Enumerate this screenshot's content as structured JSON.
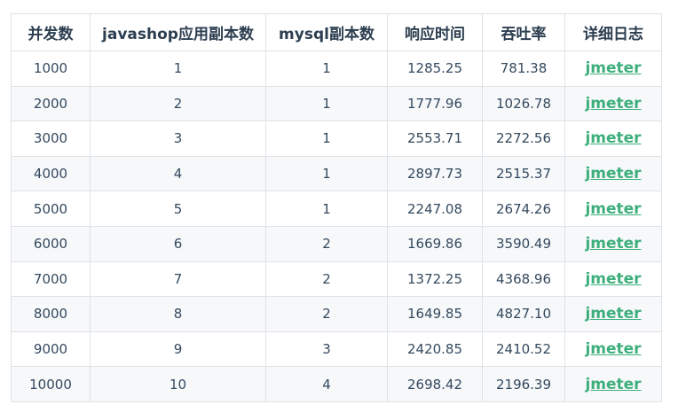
{
  "table": {
    "headers": [
      "并发数",
      "javashop应用副本数",
      "mysql副本数",
      "响应时间",
      "吞吐率",
      "详细日志"
    ],
    "rows": [
      {
        "concurrency": "1000",
        "app_replicas": "1",
        "mysql_replicas": "1",
        "response_time": "1285.25",
        "throughput": "781.38",
        "log": "jmeter"
      },
      {
        "concurrency": "2000",
        "app_replicas": "2",
        "mysql_replicas": "1",
        "response_time": "1777.96",
        "throughput": "1026.78",
        "log": "jmeter"
      },
      {
        "concurrency": "3000",
        "app_replicas": "3",
        "mysql_replicas": "1",
        "response_time": "2553.71",
        "throughput": "2272.56",
        "log": "jmeter"
      },
      {
        "concurrency": "4000",
        "app_replicas": "4",
        "mysql_replicas": "1",
        "response_time": "2897.73",
        "throughput": "2515.37",
        "log": "jmeter"
      },
      {
        "concurrency": "5000",
        "app_replicas": "5",
        "mysql_replicas": "1",
        "response_time": "2247.08",
        "throughput": "2674.26",
        "log": "jmeter"
      },
      {
        "concurrency": "6000",
        "app_replicas": "6",
        "mysql_replicas": "2",
        "response_time": "1669.86",
        "throughput": "3590.49",
        "log": "jmeter"
      },
      {
        "concurrency": "7000",
        "app_replicas": "7",
        "mysql_replicas": "2",
        "response_time": "1372.25",
        "throughput": "4368.96",
        "log": "jmeter"
      },
      {
        "concurrency": "8000",
        "app_replicas": "8",
        "mysql_replicas": "2",
        "response_time": "1649.85",
        "throughput": "4827.10",
        "log": "jmeter"
      },
      {
        "concurrency": "9000",
        "app_replicas": "9",
        "mysql_replicas": "3",
        "response_time": "2420.85",
        "throughput": "2410.52",
        "log": "jmeter"
      },
      {
        "concurrency": "10000",
        "app_replicas": "10",
        "mysql_replicas": "4",
        "response_time": "2698.42",
        "throughput": "2196.39",
        "log": "jmeter"
      }
    ]
  },
  "colors": {
    "link": "#3eaf7c",
    "header_text": "#2c3e50",
    "cell_text": "#34495e",
    "border": "#dfe2e5",
    "stripe": "#f6f8fa"
  }
}
